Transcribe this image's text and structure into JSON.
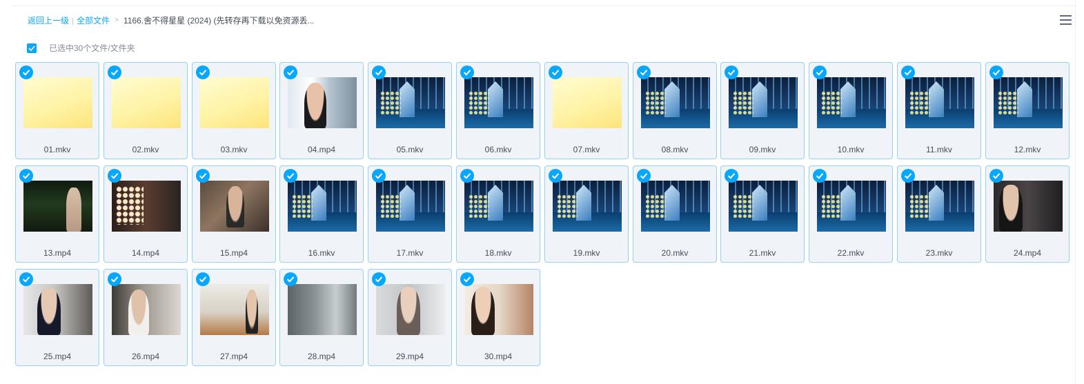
{
  "breadcrumb": {
    "back_label": "返回上一级",
    "root_label": "全部文件",
    "current_folder": "1166.舍不得星星 (2024) (先转存再下载以免资源丢..."
  },
  "selection": {
    "checked": true,
    "status_text": "已选中30个文件/文件夹"
  },
  "colors": {
    "accent": "#06A7FF",
    "link": "#09AAFF",
    "tile_border": "#91D2F8",
    "tile_bg": "#F0F4F9"
  },
  "files": [
    {
      "name": "01.mkv",
      "thumb": "yellow",
      "selected": true
    },
    {
      "name": "02.mkv",
      "thumb": "yellow",
      "selected": true
    },
    {
      "name": "03.mkv",
      "thumb": "yellow",
      "selected": true
    },
    {
      "name": "04.mp4",
      "thumb": "office",
      "selected": true
    },
    {
      "name": "05.mkv",
      "thumb": "city",
      "selected": true
    },
    {
      "name": "06.mkv",
      "thumb": "city",
      "selected": true
    },
    {
      "name": "07.mkv",
      "thumb": "yellow",
      "selected": true
    },
    {
      "name": "08.mkv",
      "thumb": "city",
      "selected": true
    },
    {
      "name": "09.mkv",
      "thumb": "city",
      "selected": true
    },
    {
      "name": "10.mkv",
      "thumb": "city",
      "selected": true
    },
    {
      "name": "11.mkv",
      "thumb": "city",
      "selected": true
    },
    {
      "name": "12.mkv",
      "thumb": "city",
      "selected": true
    },
    {
      "name": "13.mp4",
      "thumb": "night",
      "selected": true
    },
    {
      "name": "14.mp4",
      "thumb": "sign",
      "selected": true
    },
    {
      "name": "15.mp4",
      "thumb": "indoor",
      "selected": true
    },
    {
      "name": "16.mkv",
      "thumb": "city",
      "selected": true
    },
    {
      "name": "17.mkv",
      "thumb": "city",
      "selected": true
    },
    {
      "name": "18.mkv",
      "thumb": "city",
      "selected": true
    },
    {
      "name": "19.mkv",
      "thumb": "city",
      "selected": true
    },
    {
      "name": "20.mkv",
      "thumb": "city",
      "selected": true
    },
    {
      "name": "21.mkv",
      "thumb": "city",
      "selected": true
    },
    {
      "name": "22.mkv",
      "thumb": "city",
      "selected": true
    },
    {
      "name": "23.mkv",
      "thumb": "city",
      "selected": true
    },
    {
      "name": "24.mp4",
      "thumb": "dark",
      "selected": true
    },
    {
      "name": "25.mp4",
      "thumb": "suit",
      "selected": true
    },
    {
      "name": "26.mp4",
      "thumb": "white",
      "selected": true
    },
    {
      "name": "27.mp4",
      "thumb": "room",
      "selected": true
    },
    {
      "name": "28.mp4",
      "thumb": "grey",
      "selected": true
    },
    {
      "name": "29.mp4",
      "thumb": "pale",
      "selected": true
    },
    {
      "name": "30.mp4",
      "thumb": "warm",
      "selected": true
    }
  ]
}
